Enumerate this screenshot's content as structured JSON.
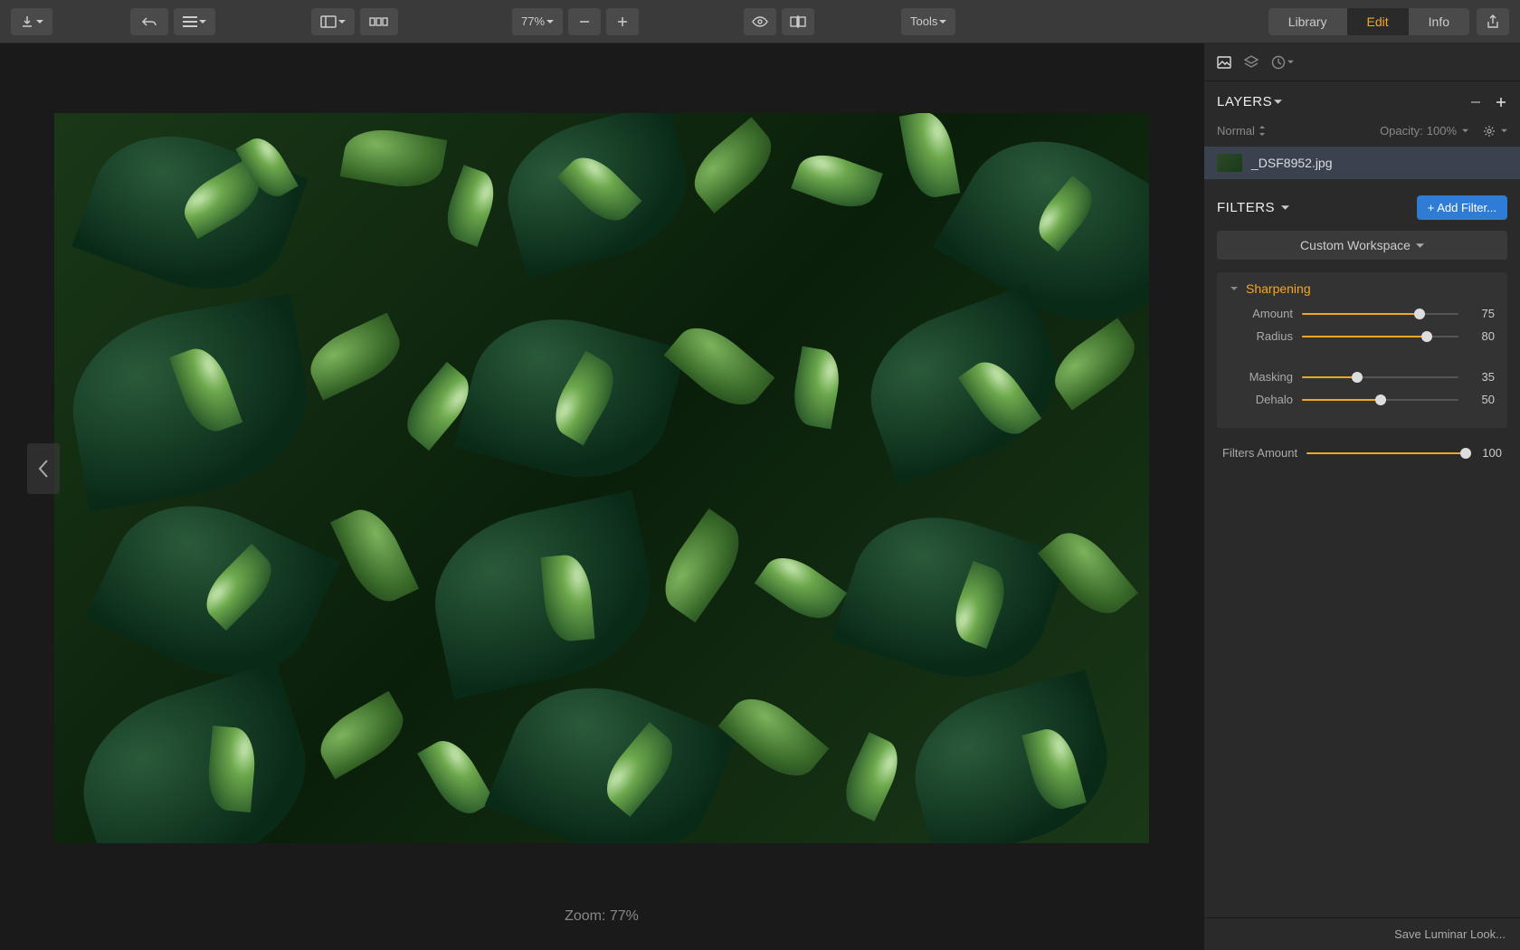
{
  "toolbar": {
    "zoom_level": "77%",
    "tools_label": "Tools",
    "tabs": {
      "library": "Library",
      "edit": "Edit",
      "info": "Info"
    }
  },
  "canvas": {
    "zoom_text": "Zoom: 77%"
  },
  "layers": {
    "title": "LAYERS",
    "blend_mode": "Normal",
    "opacity_label": "Opacity:",
    "opacity_value": "100%",
    "items": [
      {
        "name": "_DSF8952.jpg"
      }
    ]
  },
  "filters": {
    "title": "FILTERS",
    "add_button": "+ Add Filter...",
    "workspace": "Custom Workspace",
    "panels": {
      "sharpening": {
        "title": "Sharpening",
        "amount": {
          "label": "Amount",
          "value": 75
        },
        "radius": {
          "label": "Radius",
          "value": 80
        },
        "masking": {
          "label": "Masking",
          "value": 35
        },
        "dehalo": {
          "label": "Dehalo",
          "value": 50
        }
      }
    },
    "amount": {
      "label": "Filters Amount",
      "value": 100
    }
  },
  "footer": {
    "save_look": "Save Luminar Look..."
  }
}
